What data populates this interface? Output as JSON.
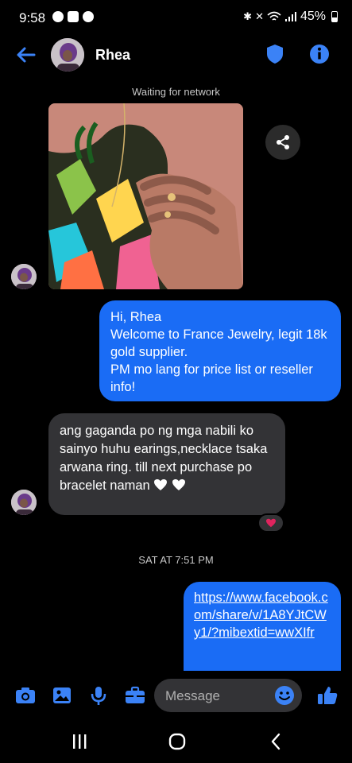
{
  "status_bar": {
    "time": "9:58",
    "battery": "45%"
  },
  "header": {
    "contact_name": "Rhea"
  },
  "conversation": {
    "network_status": "Waiting for network",
    "outgoing_message": "Hi, Rhea\nWelcome to France Jewelry, legit 18k gold supplier.\nPM mo lang for price list or reseller info!",
    "incoming_message": "ang gaganda po ng mga nabili ko sainyo huhu earings,necklace tsaka arwana ring. till next purchase po bracelet naman",
    "timestamp": "SAT AT 7:51 PM",
    "link_message": "https://www.facebook.com/share/v/1A8YJtCWy1/?mibextid=wwXIfr"
  },
  "composer": {
    "placeholder": "Message"
  },
  "colors": {
    "accent": "#1a6cf5",
    "icon_blue": "#3b82f6",
    "incoming_bubble": "#333336",
    "background": "#000000",
    "reaction_heart": "#e0245e"
  },
  "icons": {
    "header": [
      "back-arrow-icon",
      "shield-icon",
      "info-icon"
    ],
    "composer": [
      "camera-icon",
      "gallery-icon",
      "microphone-icon",
      "briefcase-icon",
      "emoji-icon",
      "thumbs-up-icon"
    ],
    "navigation": [
      "recent-apps-icon",
      "home-icon",
      "back-icon"
    ]
  }
}
